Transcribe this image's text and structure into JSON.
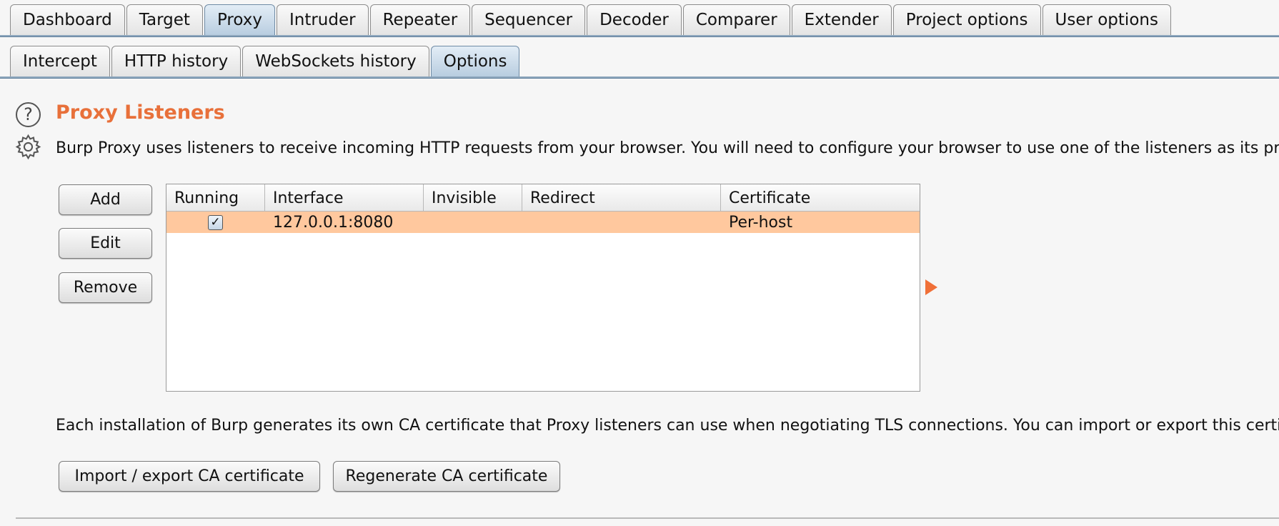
{
  "top_tabs": [
    "Dashboard",
    "Target",
    "Proxy",
    "Intruder",
    "Repeater",
    "Sequencer",
    "Decoder",
    "Comparer",
    "Extender",
    "Project options",
    "User options"
  ],
  "top_selected": "Proxy",
  "sub_tabs": [
    "Intercept",
    "HTTP history",
    "WebSockets history",
    "Options"
  ],
  "sub_selected": "Options",
  "section": {
    "title": "Proxy Listeners",
    "description": "Burp Proxy uses listeners to receive incoming HTTP requests from your browser. You will need to configure your browser to use one of the listeners as its proxy",
    "help_icon_glyph": "?"
  },
  "side_buttons": {
    "add": "Add",
    "edit": "Edit",
    "remove": "Remove"
  },
  "table": {
    "columns": [
      "Running",
      "Interface",
      "Invisible",
      "Redirect",
      "Certificate"
    ],
    "rows": [
      {
        "running": true,
        "running_glyph": "✓",
        "interface": "127.0.0.1:8080",
        "invisible": "",
        "redirect": "",
        "certificate": "Per-host"
      }
    ],
    "selected_row_color": "#ffc89e"
  },
  "ca": {
    "description": "Each installation of Burp generates its own CA certificate that Proxy listeners can use when negotiating TLS connections. You can import or export this certificate",
    "import_export_label": "Import / export CA certificate",
    "regenerate_label": "Regenerate CA certificate"
  },
  "accent_color": "#e8703a"
}
